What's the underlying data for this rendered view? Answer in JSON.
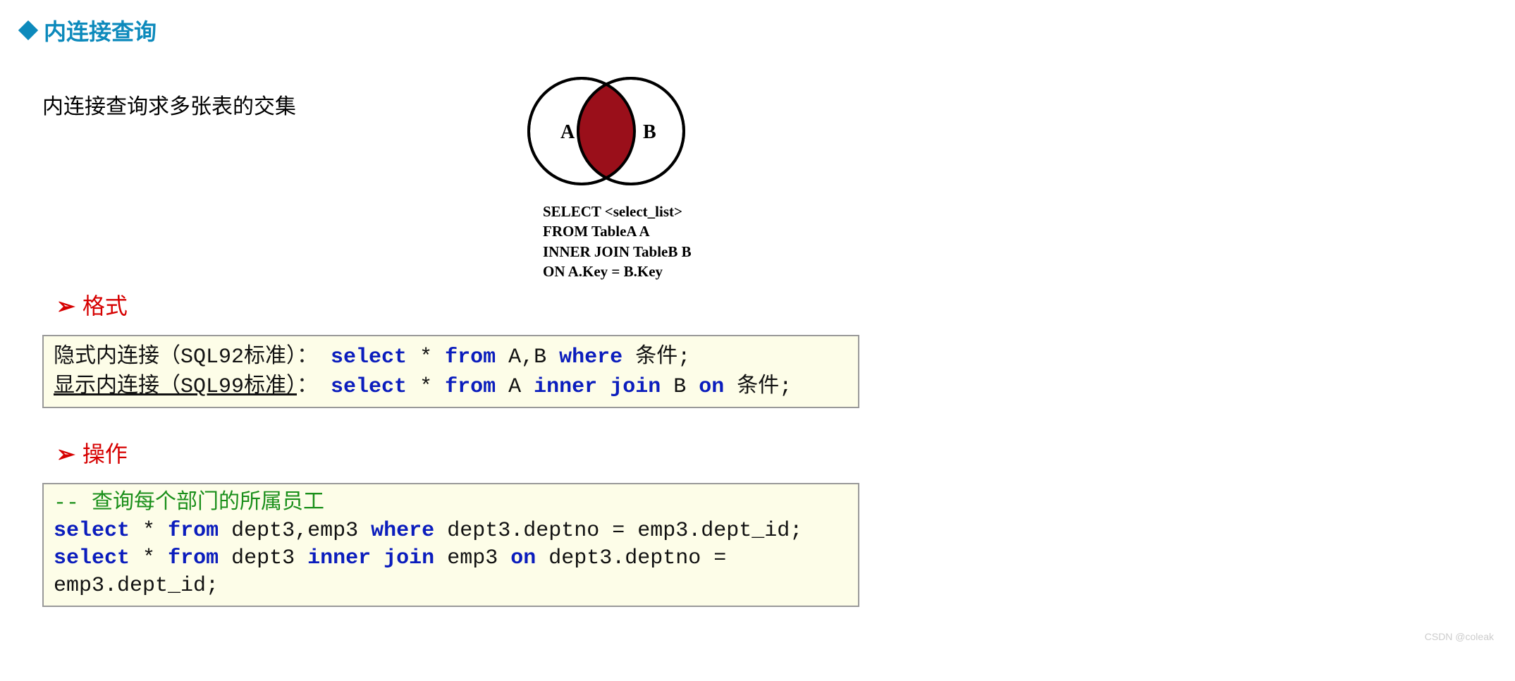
{
  "section": {
    "title": "内连接查询"
  },
  "intro": {
    "text": "内连接查询求多张表的交集"
  },
  "venn": {
    "labelA": "A",
    "labelB": "B",
    "sql_line1": "SELECT <select_list>",
    "sql_line2": "FROM TableA A",
    "sql_line3": "INNER JOIN TableB B",
    "sql_line4": "ON A.Key = B.Key"
  },
  "sub1": {
    "label": "格式",
    "arrow": "➢"
  },
  "box1": {
    "l1_pre": "隐式内连接（SQL92标准）",
    "colon": "：",
    "sel": "select",
    "star": "*",
    "from": "from",
    "ab": "A,B",
    "where": "where",
    "cond": "条件;",
    "l2_pre": "显示内连接（SQL99标准）",
    "a": "A",
    "inner": "inner",
    "join": "join",
    "b": "B",
    "on": "on"
  },
  "sub2": {
    "label": "操作",
    "arrow": "➢"
  },
  "box2": {
    "comment": "-- 查询每个部门的所属员工",
    "sel": "select",
    "star": "*",
    "from": "from",
    "tables_comma": "dept3,emp3",
    "where": "where",
    "cond1": "dept3.deptno = emp3.dept_id;",
    "dept3": "dept3",
    "inner": "inner",
    "join": "join",
    "emp3": "emp3",
    "on": "on",
    "cond2a": "dept3.deptno =",
    "cond2b": "emp3.dept_id;"
  },
  "watermark": "CSDN @coleak",
  "chart_data": {
    "type": "venn",
    "sets": [
      {
        "name": "A",
        "label": "TableA"
      },
      {
        "name": "B",
        "label": "TableB"
      }
    ],
    "highlight": "intersection",
    "title": "INNER JOIN"
  }
}
